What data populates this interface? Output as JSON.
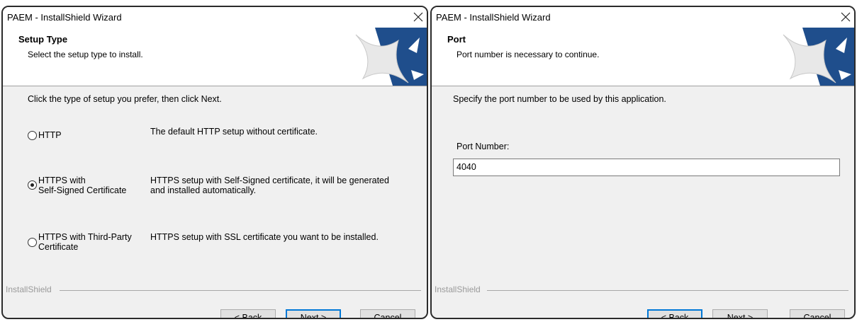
{
  "left_window": {
    "title": "PAEM - InstallShield Wizard",
    "header_title": "Setup Type",
    "header_subtitle": "Select the setup type to install.",
    "intro": "Click the type of setup you prefer, then click Next.",
    "options": [
      {
        "label_line1": "HTTP",
        "label_line2": "",
        "description_line1": "The default HTTP setup without certificate.",
        "description_line2": "",
        "selected": false
      },
      {
        "label_line1": "HTTPS with",
        "label_line2": "Self-Signed Certificate",
        "description_line1": "HTTPS setup with Self-Signed certificate, it will be generated",
        "description_line2": "and installed automatically.",
        "selected": true
      },
      {
        "label_line1": "HTTPS with Third-Party",
        "label_line2": "Certificate",
        "description_line1": "HTTPS setup with SSL certificate you want to be installed.",
        "description_line2": "",
        "selected": false
      }
    ],
    "brand": "InstallShield",
    "buttons": {
      "back": "< Back",
      "next": "Next >",
      "cancel": "Cancel"
    }
  },
  "right_window": {
    "title": "PAEM - InstallShield Wizard",
    "header_title": "Port",
    "header_subtitle": "Port number is necessary to continue.",
    "intro": "Specify the port number to be used by this application.",
    "field_label": "Port Number:",
    "port_value": "4040",
    "brand": "InstallShield",
    "buttons": {
      "back": "< Back",
      "next": "Next >",
      "cancel": "Cancel"
    }
  },
  "colors": {
    "accent": "#0078d7",
    "logo_blue": "#1f4e8c"
  },
  "icons": {
    "close": "close-icon",
    "logo": "installshield-logo-icon"
  }
}
